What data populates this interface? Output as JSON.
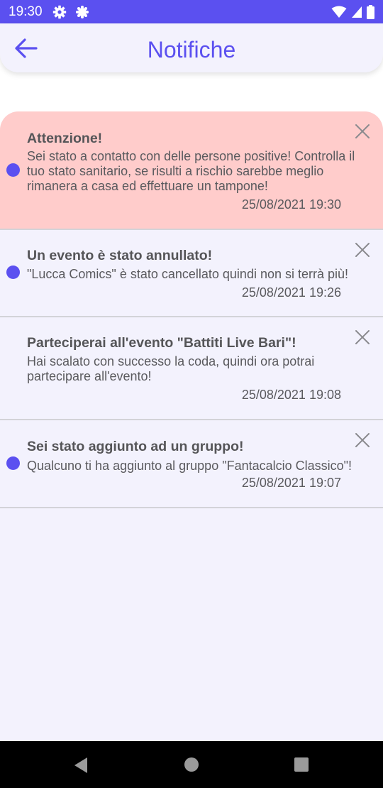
{
  "status_bar": {
    "time": "19:30",
    "left_icons": [
      "gear-icon",
      "settings-icon"
    ],
    "right_icons": [
      "wifi-icon",
      "signal-icon",
      "battery-icon"
    ]
  },
  "header": {
    "title": "Notifiche",
    "back_icon": "arrow-back-icon"
  },
  "notifications": [
    {
      "title": "Attenzione!",
      "body": "Sei stato a contatto con delle persone positive! Controlla il tuo stato sanitario, se risulti a rischio sarebbe meglio rimanera a casa ed effettuare un tampone!",
      "date": "25/08/2021 19:30",
      "unread": true,
      "alert": true
    },
    {
      "title": "Un evento è stato annullato!",
      "body": " \"Lucca Comics\" è stato cancellato quindi non si terrà più!",
      "date": "25/08/2021 19:26",
      "unread": true,
      "alert": false
    },
    {
      "title": "Parteciperai all'evento \"Battiti Live Bari\"!",
      "body": "Hai scalato con successo la coda, quindi ora potrai partecipare all'evento!",
      "date": "25/08/2021 19:08",
      "unread": false,
      "alert": false
    },
    {
      "title": "Sei stato aggiunto ad un gruppo!",
      "body": "Qualcuno ti ha aggiunto al gruppo \"Fantacalcio Classico\"!",
      "date": "25/08/2021 19:07",
      "unread": true,
      "alert": false
    }
  ],
  "nav_bar": {
    "buttons": [
      "back-triangle-icon",
      "home-circle-icon",
      "recents-square-icon"
    ]
  },
  "colors": {
    "accent": "#5b50f0",
    "alert_background": "#ffcccb",
    "panel_background": "#f3f2fd"
  }
}
